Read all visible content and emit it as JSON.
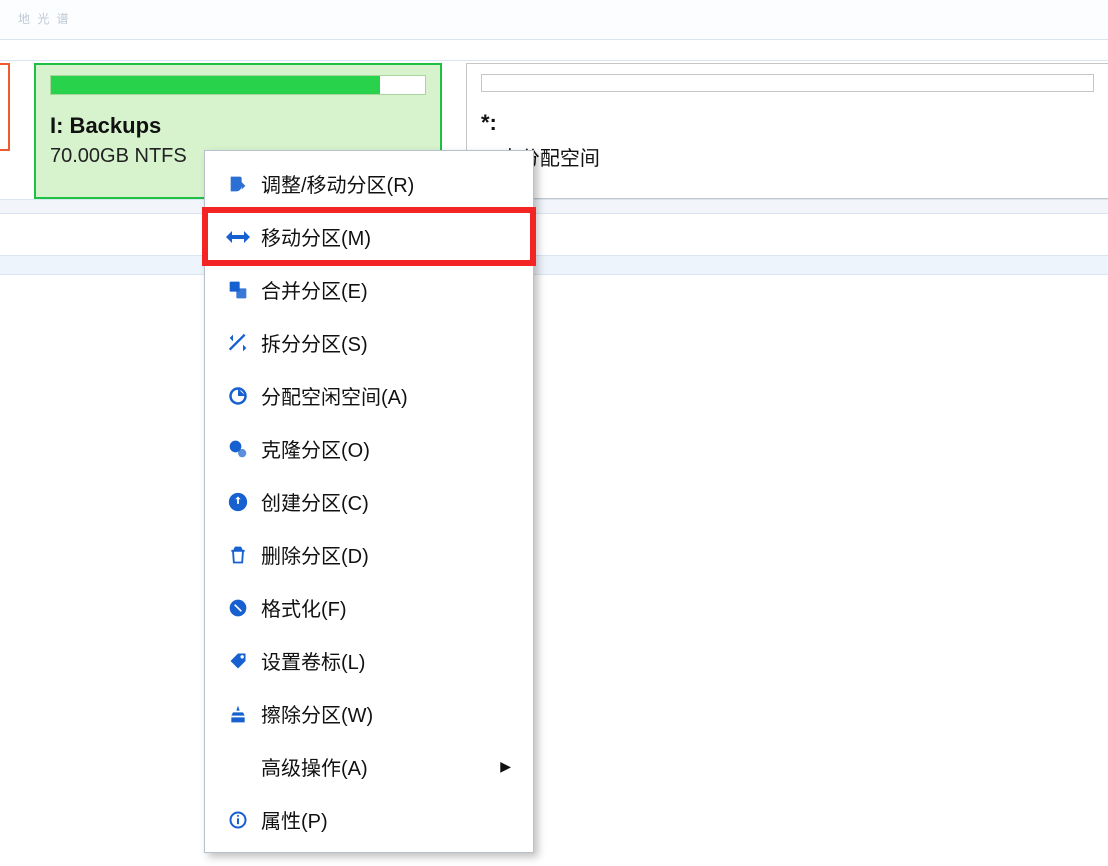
{
  "top_bar": {
    "faint": "地 光 谱"
  },
  "partition": {
    "title": "I: Backups",
    "subtitle": "70.00GB NTFS",
    "usage_percent": 88
  },
  "unallocated": {
    "title": "*:",
    "subtitle_suffix": "B 未分配空间"
  },
  "menu": {
    "items": [
      {
        "label": "调整/移动分区(R)"
      },
      {
        "label": "移动分区(M)",
        "highlight": true
      },
      {
        "label": "合并分区(E)"
      },
      {
        "label": "拆分分区(S)"
      },
      {
        "label": "分配空闲空间(A)"
      },
      {
        "label": "克隆分区(O)"
      },
      {
        "label": "创建分区(C)"
      },
      {
        "label": "删除分区(D)"
      },
      {
        "label": "格式化(F)"
      },
      {
        "label": "设置卷标(L)"
      },
      {
        "label": "擦除分区(W)"
      },
      {
        "label": "高级操作(A)",
        "submenu": true
      },
      {
        "label": "属性(P)"
      }
    ]
  }
}
